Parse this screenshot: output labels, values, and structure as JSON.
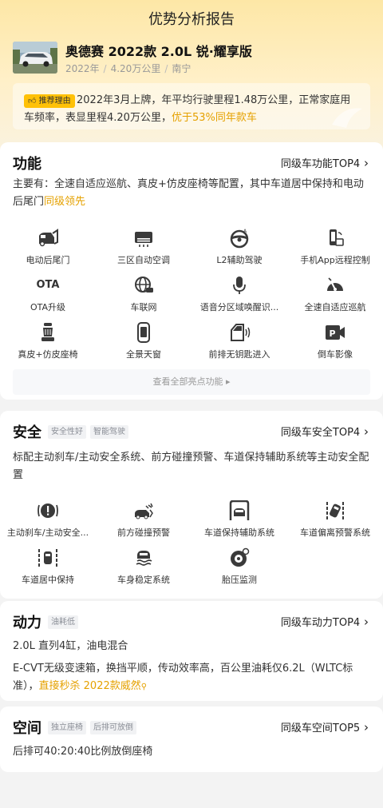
{
  "page_title": "优势分析报告",
  "car": {
    "name": "奥德赛 2022款 2.0L 锐·耀享版",
    "year": "2022年",
    "mileage": "4.20万公里",
    "city": "南宁"
  },
  "reason": {
    "badge": "推荐理由",
    "text": "2022年3月上牌，年平均行驶里程1.48万公里，正常家庭用车频率，表显里程4.20万公里，",
    "highlight": "优于53%同年款车"
  },
  "features": {
    "title": "功能",
    "rank": "同级车功能TOP4",
    "desc": "主要有：全速自适应巡航、真皮+仿皮座椅等配置，其中车道居中保持和电动后尾门",
    "desc_highlight": "同级领先",
    "items": [
      {
        "label": "电动后尾门",
        "icon": "tailgate-icon"
      },
      {
        "label": "三区自动空调",
        "icon": "air-conditioner-icon"
      },
      {
        "label": "L2辅助驾驶",
        "icon": "steering-wheel-icon"
      },
      {
        "label": "手机App远程控制",
        "icon": "phone-remote-icon"
      },
      {
        "label": "OTA升级",
        "icon": "ota-icon",
        "icon_text": "OTA"
      },
      {
        "label": "车联网",
        "icon": "globe-icon"
      },
      {
        "label": "语音分区域唤醒识...",
        "icon": "microphone-icon"
      },
      {
        "label": "全速自适应巡航",
        "icon": "speedometer-icon"
      },
      {
        "label": "真皮+仿皮座椅",
        "icon": "seat-icon"
      },
      {
        "label": "全景天窗",
        "icon": "sunroof-icon"
      },
      {
        "label": "前排无钥匙进入",
        "icon": "keyless-door-icon"
      },
      {
        "label": "倒车影像",
        "icon": "reverse-camera-icon"
      }
    ],
    "view_all": "查看全部亮点功能"
  },
  "safety": {
    "title": "安全",
    "tags": [
      "安全性好",
      "智能驾驶"
    ],
    "rank": "同级车安全TOP4",
    "desc": "标配主动刹车/主动安全系统、前方碰撞预警、车道保持辅助系统等主动安全配置",
    "items": [
      {
        "label": "主动刹车/主动安全...",
        "icon": "brake-warning-icon"
      },
      {
        "label": "前方碰撞预警",
        "icon": "collision-warning-icon"
      },
      {
        "label": "车道保持辅助系统",
        "icon": "lane-keep-icon"
      },
      {
        "label": "车道偏离预警系统",
        "icon": "lane-departure-icon"
      },
      {
        "label": "车道居中保持",
        "icon": "lane-center-icon"
      },
      {
        "label": "车身稳定系统",
        "icon": "stability-icon"
      },
      {
        "label": "胎压监测",
        "icon": "tire-pressure-icon"
      }
    ]
  },
  "power": {
    "title": "动力",
    "tags": [
      "油耗低"
    ],
    "rank": "同级车动力TOP4",
    "line1": "2.0L 直列4缸，油电混合",
    "desc": "E-CVT无级变速箱，换挡平顺，传动效率高，百公里油耗仅6.2L（WLTC标准），",
    "link": "直接秒杀 2022款威然"
  },
  "space": {
    "title": "空间",
    "tags": [
      "独立座椅",
      "后排可放倒"
    ],
    "rank": "同级车空间TOP5",
    "desc": "后排可40:20:40比例放倒座椅"
  },
  "colors": {
    "accent": "#e5a100",
    "badge": "#ffc107",
    "header_gradient_top": "#fde7a6"
  }
}
